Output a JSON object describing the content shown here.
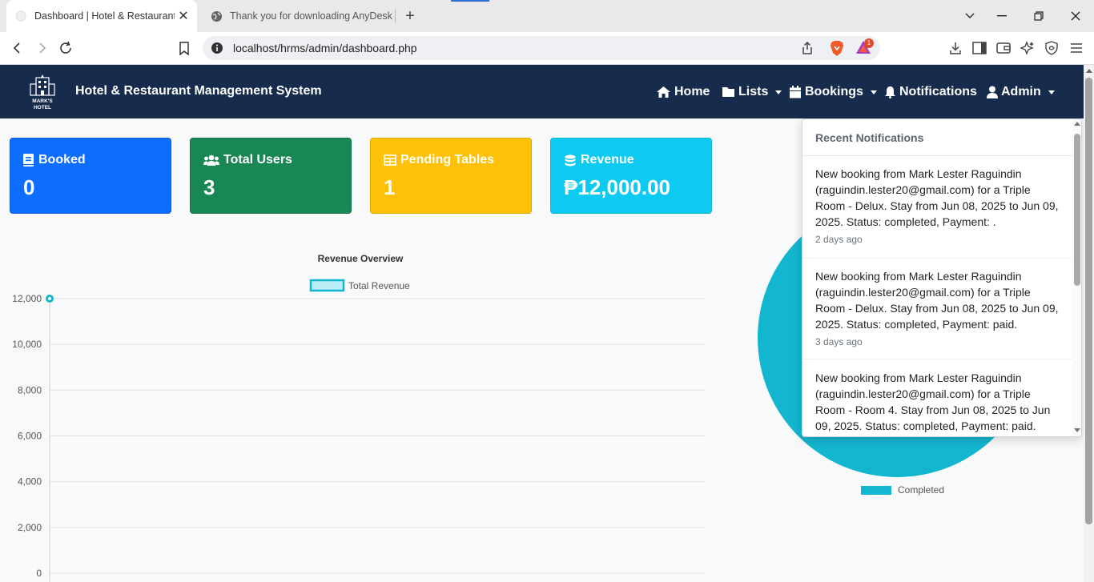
{
  "browser": {
    "tabs": [
      {
        "title": "Dashboard | Hotel & Restaurant",
        "active": true
      },
      {
        "title": "Thank you for downloading AnyDesk",
        "active": false
      }
    ],
    "new_tab_label": "+",
    "url": "localhost/hrms/admin/dashboard.php",
    "rewards_badge": "1"
  },
  "navbar": {
    "logo_text_1": "MARK'S",
    "logo_text_2": "HOTEL",
    "title": "Hotel & Restaurant Management System",
    "items": [
      {
        "label": "Home",
        "icon": "home-icon"
      },
      {
        "label": "Lists",
        "icon": "folder-icon"
      },
      {
        "label": "Bookings",
        "icon": "calendar-icon"
      },
      {
        "label": "Notifications",
        "icon": "bell-icon"
      },
      {
        "label": "Admin",
        "icon": "user-icon"
      }
    ]
  },
  "cards": [
    {
      "label": "Booked",
      "value": "0",
      "icon": "book-icon",
      "color": "#0d6efd"
    },
    {
      "label": "Total Users",
      "value": "3",
      "icon": "users-icon",
      "color": "#198754"
    },
    {
      "label": "Pending Tables",
      "value": "1",
      "icon": "table-icon",
      "color": "#ffc107"
    },
    {
      "label": "Revenue",
      "value": "₱12,000.00",
      "icon": "coins-icon",
      "color": "#0dcaf0"
    }
  ],
  "chart_data": [
    {
      "type": "line",
      "title": "Revenue Overview",
      "series": [
        {
          "name": "Total Revenue",
          "values": [
            12000
          ]
        }
      ],
      "x": [
        ""
      ],
      "ylim": [
        0,
        12000
      ],
      "yticks": [
        "12,000",
        "10,000",
        "8,000",
        "6,000",
        "4,000",
        "2,000",
        "0"
      ],
      "grid": true,
      "legend": "top",
      "color": "#12b6cf"
    },
    {
      "type": "pie",
      "series": [
        {
          "name": "Completed",
          "values": [
            1
          ]
        }
      ],
      "legend": "bottom",
      "color": "#12b6cf"
    }
  ],
  "notifications": {
    "header": "Recent Notifications",
    "items": [
      {
        "message": "New booking from Mark Lester Raguindin (raguindin.lester20@gmail.com) for a Triple Room - Delux. Stay from Jun 08, 2025 to Jun 09, 2025. Status: completed, Payment: .",
        "time": "2 days ago"
      },
      {
        "message": "New booking from Mark Lester Raguindin (raguindin.lester20@gmail.com) for a Triple Room - Delux. Stay from Jun 08, 2025 to Jun 09, 2025. Status: completed, Payment: paid.",
        "time": "3 days ago"
      },
      {
        "message": "New booking from Mark Lester Raguindin (raguindin.lester20@gmail.com) for a Triple Room - Room 4. Stay from Jun 08, 2025 to Jun 09, 2025. Status: completed, Payment: paid.",
        "time": ""
      }
    ]
  }
}
